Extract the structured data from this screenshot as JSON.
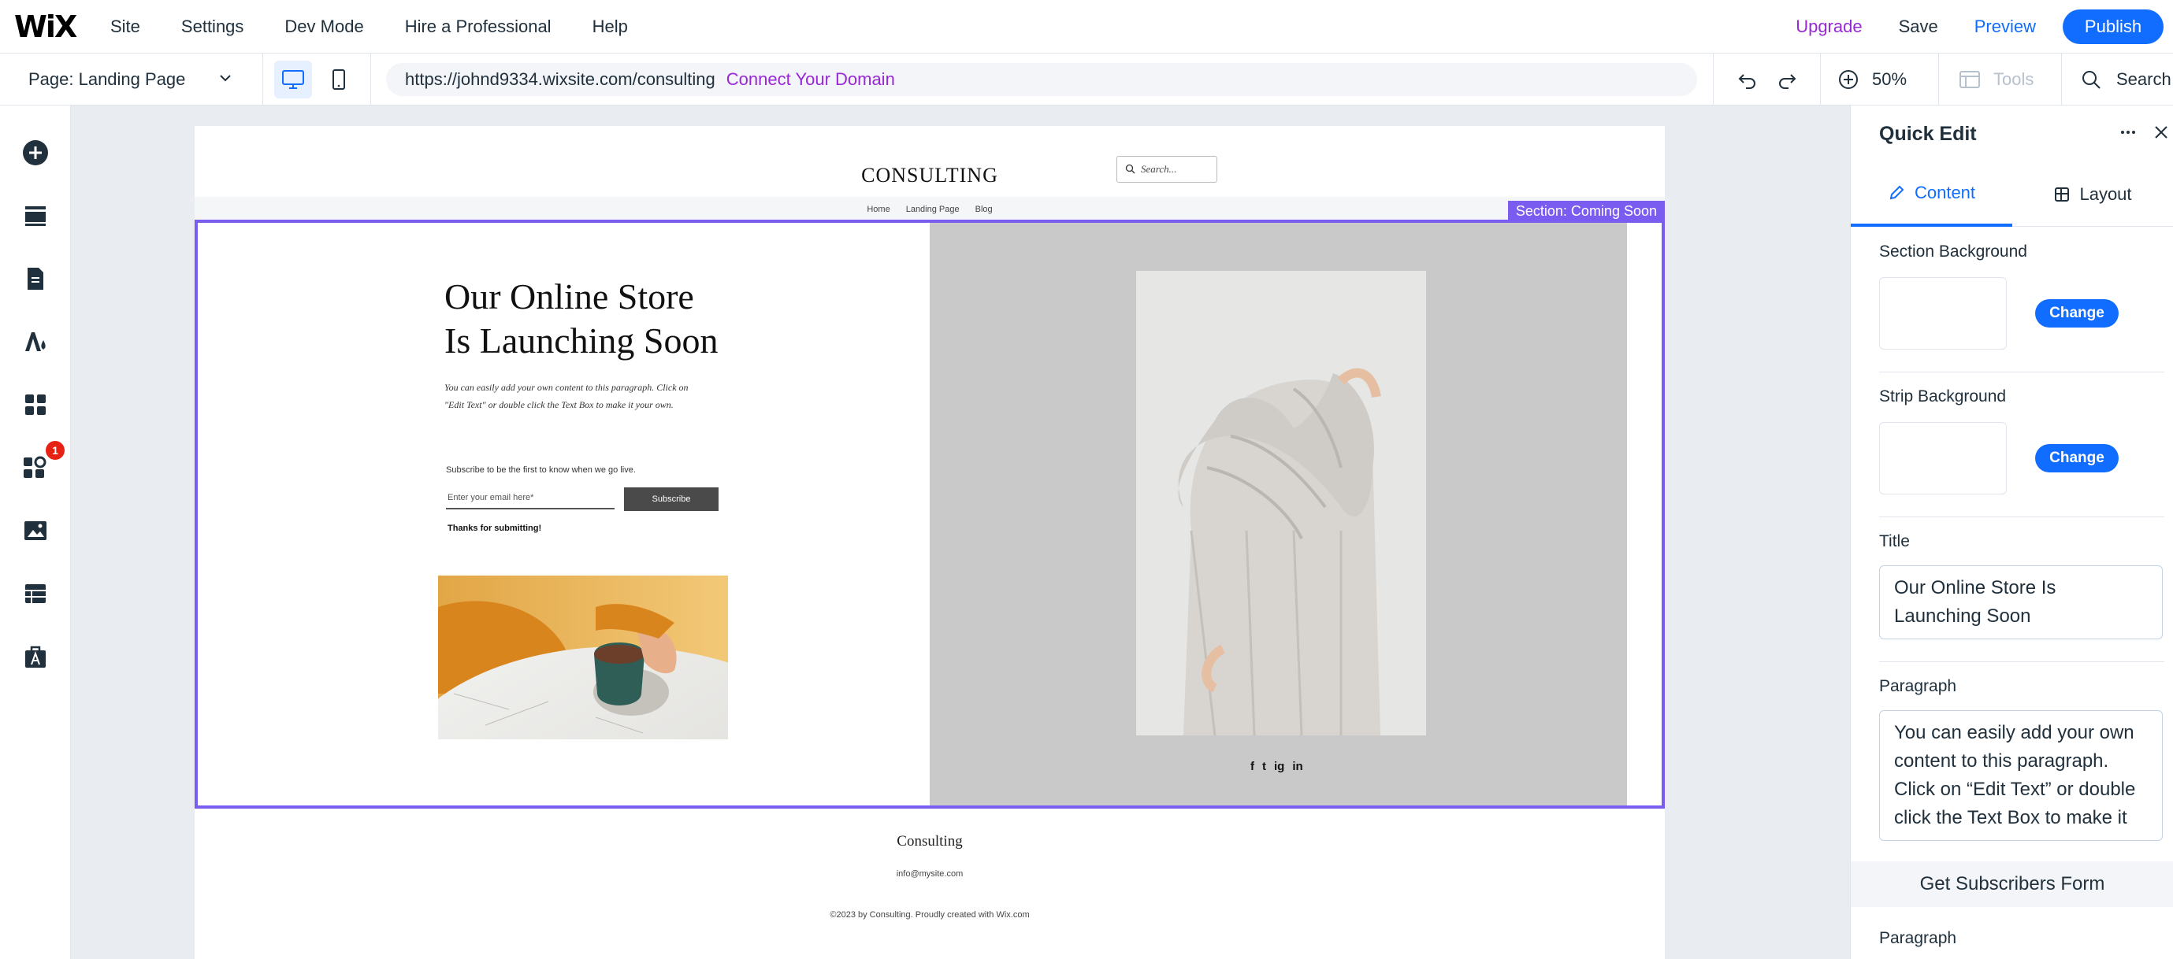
{
  "topbar": {
    "logo": "WiX",
    "menu": [
      "Site",
      "Settings",
      "Dev Mode",
      "Hire a Professional",
      "Help"
    ],
    "upgrade": "Upgrade",
    "save": "Save",
    "preview": "Preview",
    "publish": "Publish"
  },
  "toolbar": {
    "page_selector": "Page: Landing Page",
    "url": "https://johnd9334.wixsite.com/consulting",
    "connect_domain": "Connect Your Domain",
    "zoom": "50%",
    "tools": "Tools",
    "search": "Search"
  },
  "leftbar": {
    "icons": [
      "add-icon",
      "sections-icon",
      "pages-icon",
      "design-icon",
      "apps-icon",
      "business-apps-icon",
      "media-icon",
      "cms-icon",
      "portfolio-icon"
    ],
    "badge_count": "1"
  },
  "site": {
    "title": "CONSULTING",
    "search_placeholder": "Search...",
    "nav": [
      "Home",
      "Landing Page",
      "Blog"
    ],
    "section_label": "Section: Coming Soon",
    "headline_line1": "Our Online Store",
    "headline_line2": "Is Launching Soon",
    "paragraph": "You can easily add your own content to this paragraph. Click on \"Edit Text\" or double click the Text Box to make it your own.",
    "subscribe_hint": "Subscribe to be the first to know when we go live.",
    "email_placeholder": "Enter your email here*",
    "subscribe_button": "Subscribe",
    "thanks": "Thanks for submitting!",
    "socials": [
      "f",
      "t",
      "ig",
      "in"
    ],
    "footer_title": "Consulting",
    "footer_email": "info@mysite.com",
    "footer_copy": "©2023 by Consulting. Proudly created with Wix.com"
  },
  "panel": {
    "title": "Quick Edit",
    "tab_content": "Content",
    "tab_layout": "Layout",
    "section_background": "Section Background",
    "strip_background": "Strip Background",
    "change": "Change",
    "title_label": "Title",
    "title_value": "Our Online Store Is Launching Soon",
    "paragraph_label": "Paragraph",
    "paragraph_value": "You can easily add your own content to this paragraph. Click on “Edit Text” or double click the Text Box to make it your own.",
    "get_subscribers_form": "Get Subscribers Form",
    "paragraph_label_2": "Paragraph"
  },
  "colors": {
    "accent": "#116dff",
    "upgrade": "#9a27d5",
    "selection": "#7b5cf0",
    "badge": "#e62214"
  }
}
